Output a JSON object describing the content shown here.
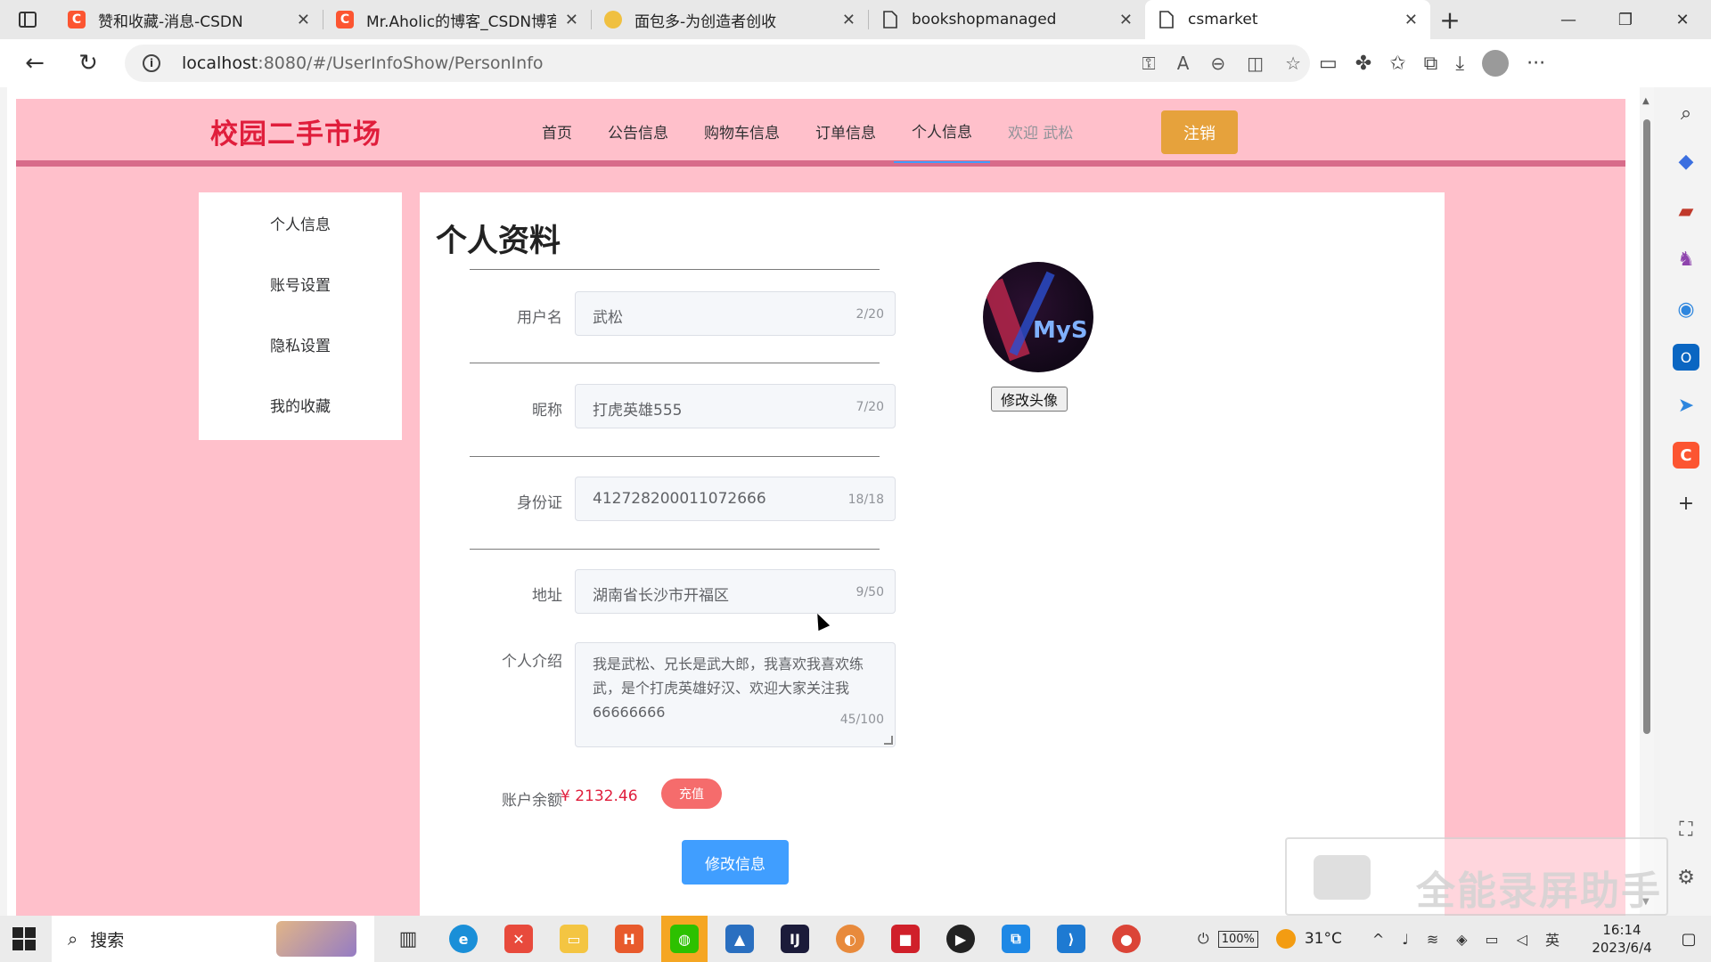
{
  "browser": {
    "tabs": [
      {
        "title": "赞和收藏-消息-CSDN",
        "favicon": "csdn-icon",
        "color": "#fc5531"
      },
      {
        "title": "Mr.Aholic的博客_CSDN博客-V",
        "favicon": "csdn-icon",
        "color": "#fc5531"
      },
      {
        "title": "面包多-为创造者创收",
        "favicon": "mianbaoduo-icon",
        "color": "#f0c040"
      },
      {
        "title": "bookshopmanaged",
        "favicon": "page-icon",
        "color": "#666666"
      },
      {
        "title": "csmarket",
        "favicon": "page-icon",
        "color": "#666666"
      }
    ],
    "url_host": "localhost",
    "url_rest": ":8080/#/UserInfoShow/PersonInfo"
  },
  "site": {
    "logo": "校园二手市场",
    "menu": [
      "首页",
      "公告信息",
      "购物车信息",
      "订单信息",
      "个人信息"
    ],
    "welcome": "欢迎 武松",
    "logout": "注销",
    "accent": "#ffc0cb"
  },
  "sidebar": {
    "items": [
      "个人信息",
      "账号设置",
      "隐私设置",
      "我的收藏"
    ]
  },
  "profile": {
    "title": "个人资料",
    "username_label": "用户名",
    "username": "武松",
    "username_count": "2/20",
    "nickname_label": "昵称",
    "nickname": "打虎英雄555",
    "nickname_count": "7/20",
    "idcard_label": "身份证",
    "idcard": "412728200011072666",
    "idcard_count": "18/18",
    "address_label": "地址",
    "address": "湖南省长沙市开福区",
    "address_count": "9/50",
    "intro_label": "个人介绍",
    "intro": "我是武松、兄长是武大郎，我喜欢我喜欢练武，是个打虎英雄好汉、欢迎大家关注我66666666",
    "intro_count": "45/100",
    "balance_label": "账户余额",
    "balance": "¥ 2132.46",
    "recharge": "充值",
    "submit": "修改信息",
    "avatar_text": "MyS",
    "change_avatar": "修改头像"
  },
  "watermark": "全能录屏助手",
  "taskbar": {
    "search": "搜索",
    "battery": "100%",
    "weather": "31°C",
    "ime": "英",
    "time": "16:14",
    "date": "2023/6/4"
  }
}
